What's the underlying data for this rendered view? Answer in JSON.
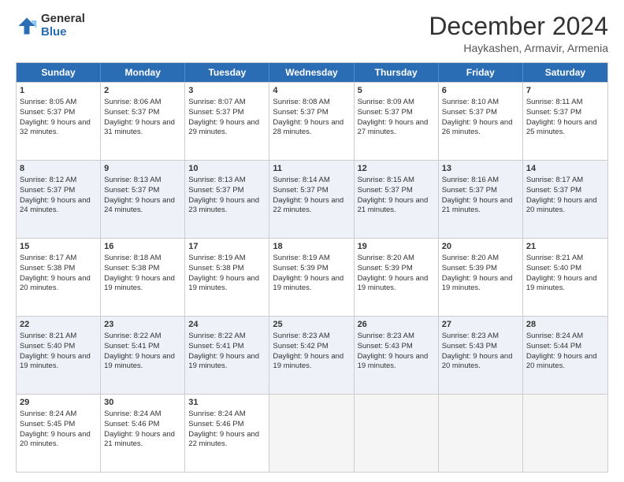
{
  "logo": {
    "general": "General",
    "blue": "Blue"
  },
  "header": {
    "title": "December 2024",
    "subtitle": "Haykashen, Armavir, Armenia"
  },
  "days": [
    "Sunday",
    "Monday",
    "Tuesday",
    "Wednesday",
    "Thursday",
    "Friday",
    "Saturday"
  ],
  "weeks": [
    [
      {
        "day": "1",
        "sunrise": "8:05 AM",
        "sunset": "5:37 PM",
        "daylight": "9 hours and 32 minutes."
      },
      {
        "day": "2",
        "sunrise": "8:06 AM",
        "sunset": "5:37 PM",
        "daylight": "9 hours and 31 minutes."
      },
      {
        "day": "3",
        "sunrise": "8:07 AM",
        "sunset": "5:37 PM",
        "daylight": "9 hours and 29 minutes."
      },
      {
        "day": "4",
        "sunrise": "8:08 AM",
        "sunset": "5:37 PM",
        "daylight": "9 hours and 28 minutes."
      },
      {
        "day": "5",
        "sunrise": "8:09 AM",
        "sunset": "5:37 PM",
        "daylight": "9 hours and 27 minutes."
      },
      {
        "day": "6",
        "sunrise": "8:10 AM",
        "sunset": "5:37 PM",
        "daylight": "9 hours and 26 minutes."
      },
      {
        "day": "7",
        "sunrise": "8:11 AM",
        "sunset": "5:37 PM",
        "daylight": "9 hours and 25 minutes."
      }
    ],
    [
      {
        "day": "8",
        "sunrise": "8:12 AM",
        "sunset": "5:37 PM",
        "daylight": "9 hours and 24 minutes."
      },
      {
        "day": "9",
        "sunrise": "8:13 AM",
        "sunset": "5:37 PM",
        "daylight": "9 hours and 24 minutes."
      },
      {
        "day": "10",
        "sunrise": "8:13 AM",
        "sunset": "5:37 PM",
        "daylight": "9 hours and 23 minutes."
      },
      {
        "day": "11",
        "sunrise": "8:14 AM",
        "sunset": "5:37 PM",
        "daylight": "9 hours and 22 minutes."
      },
      {
        "day": "12",
        "sunrise": "8:15 AM",
        "sunset": "5:37 PM",
        "daylight": "9 hours and 21 minutes."
      },
      {
        "day": "13",
        "sunrise": "8:16 AM",
        "sunset": "5:37 PM",
        "daylight": "9 hours and 21 minutes."
      },
      {
        "day": "14",
        "sunrise": "8:17 AM",
        "sunset": "5:37 PM",
        "daylight": "9 hours and 20 minutes."
      }
    ],
    [
      {
        "day": "15",
        "sunrise": "8:17 AM",
        "sunset": "5:38 PM",
        "daylight": "9 hours and 20 minutes."
      },
      {
        "day": "16",
        "sunrise": "8:18 AM",
        "sunset": "5:38 PM",
        "daylight": "9 hours and 19 minutes."
      },
      {
        "day": "17",
        "sunrise": "8:19 AM",
        "sunset": "5:38 PM",
        "daylight": "9 hours and 19 minutes."
      },
      {
        "day": "18",
        "sunrise": "8:19 AM",
        "sunset": "5:39 PM",
        "daylight": "9 hours and 19 minutes."
      },
      {
        "day": "19",
        "sunrise": "8:20 AM",
        "sunset": "5:39 PM",
        "daylight": "9 hours and 19 minutes."
      },
      {
        "day": "20",
        "sunrise": "8:20 AM",
        "sunset": "5:39 PM",
        "daylight": "9 hours and 19 minutes."
      },
      {
        "day": "21",
        "sunrise": "8:21 AM",
        "sunset": "5:40 PM",
        "daylight": "9 hours and 19 minutes."
      }
    ],
    [
      {
        "day": "22",
        "sunrise": "8:21 AM",
        "sunset": "5:40 PM",
        "daylight": "9 hours and 19 minutes."
      },
      {
        "day": "23",
        "sunrise": "8:22 AM",
        "sunset": "5:41 PM",
        "daylight": "9 hours and 19 minutes."
      },
      {
        "day": "24",
        "sunrise": "8:22 AM",
        "sunset": "5:41 PM",
        "daylight": "9 hours and 19 minutes."
      },
      {
        "day": "25",
        "sunrise": "8:23 AM",
        "sunset": "5:42 PM",
        "daylight": "9 hours and 19 minutes."
      },
      {
        "day": "26",
        "sunrise": "8:23 AM",
        "sunset": "5:43 PM",
        "daylight": "9 hours and 19 minutes."
      },
      {
        "day": "27",
        "sunrise": "8:23 AM",
        "sunset": "5:43 PM",
        "daylight": "9 hours and 20 minutes."
      },
      {
        "day": "28",
        "sunrise": "8:24 AM",
        "sunset": "5:44 PM",
        "daylight": "9 hours and 20 minutes."
      }
    ],
    [
      {
        "day": "29",
        "sunrise": "8:24 AM",
        "sunset": "5:45 PM",
        "daylight": "9 hours and 20 minutes."
      },
      {
        "day": "30",
        "sunrise": "8:24 AM",
        "sunset": "5:46 PM",
        "daylight": "9 hours and 21 minutes."
      },
      {
        "day": "31",
        "sunrise": "8:24 AM",
        "sunset": "5:46 PM",
        "daylight": "9 hours and 22 minutes."
      },
      null,
      null,
      null,
      null
    ]
  ],
  "labels": {
    "sunrise": "Sunrise:",
    "sunset": "Sunset:",
    "daylight": "Daylight:"
  }
}
